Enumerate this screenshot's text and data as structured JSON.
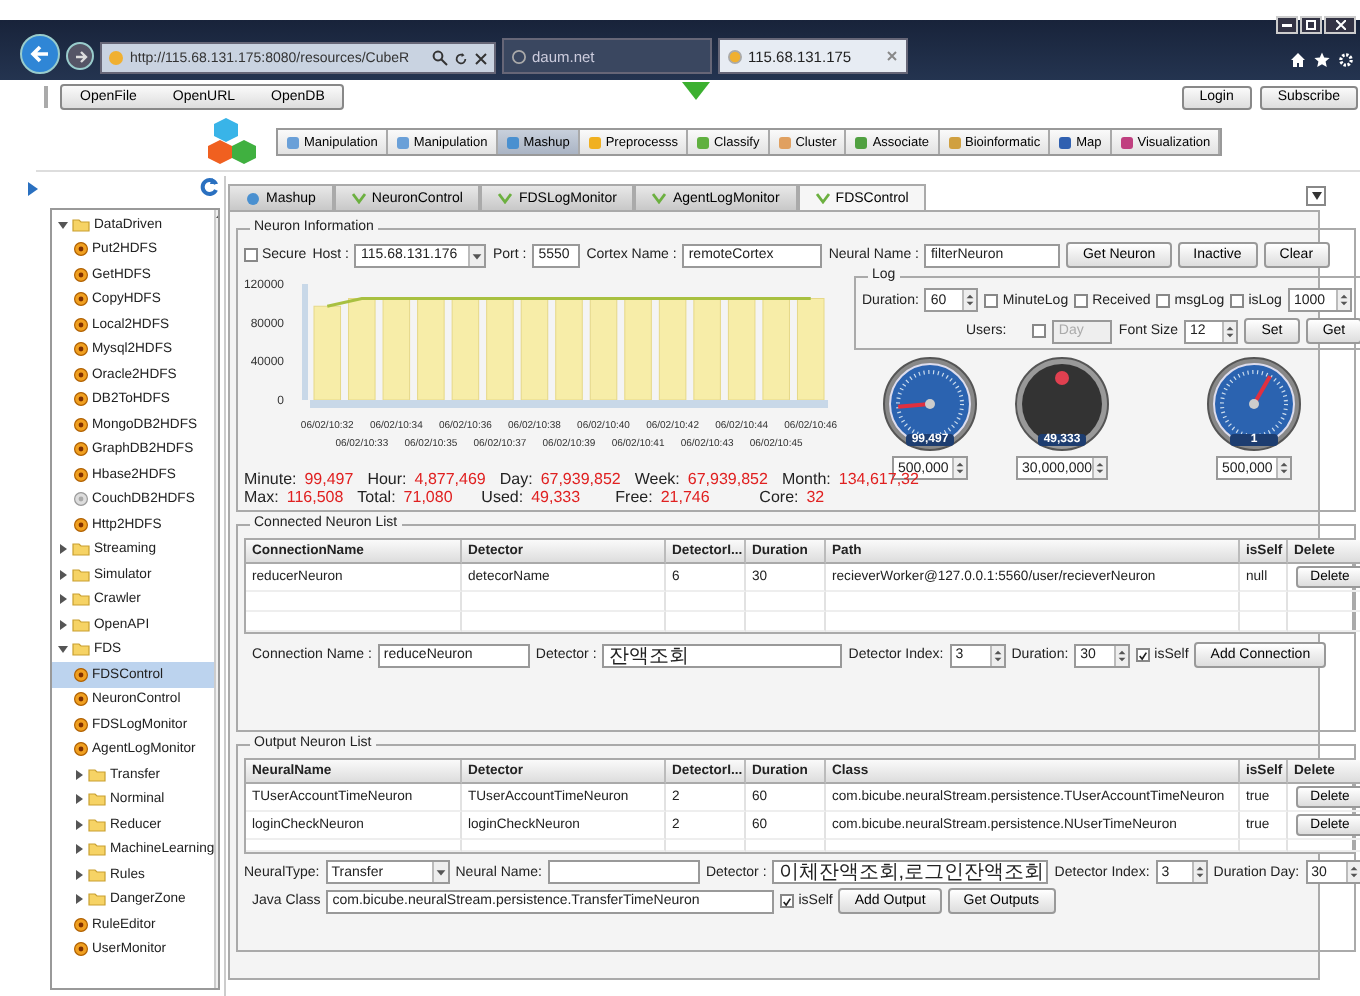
{
  "browser": {
    "address": "http://115.68.131.175:8080/resources/CubeR",
    "tabs": [
      {
        "label": "daum.net",
        "selected": false
      },
      {
        "label": "115.68.131.175",
        "selected": true
      }
    ]
  },
  "toolbar": {
    "file_buttons": [
      "OpenFile",
      "OpenURL",
      "OpenDB"
    ],
    "account_buttons": [
      "Login",
      "Subscribe"
    ]
  },
  "module_tabs": [
    {
      "label": "Manipulation",
      "selected": false
    },
    {
      "label": "Manipulation",
      "selected": false
    },
    {
      "label": "Mashup",
      "selected": true
    },
    {
      "label": "Preprocesss",
      "selected": false
    },
    {
      "label": "Classify",
      "selected": false
    },
    {
      "label": "Cluster",
      "selected": false
    },
    {
      "label": "Associate",
      "selected": false
    },
    {
      "label": "Bioinformatic",
      "selected": false
    },
    {
      "label": "Map",
      "selected": false
    },
    {
      "label": "Visualization",
      "selected": false
    }
  ],
  "sidebar": {
    "tree": [
      {
        "label": "DataDriven",
        "kind": "folder",
        "expanded": true,
        "selected": false,
        "children": [
          {
            "label": "Put2HDFS",
            "kind": "node",
            "disabled": false,
            "selected": false
          },
          {
            "label": "GetHDFS",
            "kind": "node",
            "disabled": false,
            "selected": false
          },
          {
            "label": "CopyHDFS",
            "kind": "node",
            "disabled": false,
            "selected": false
          },
          {
            "label": "Local2HDFS",
            "kind": "node",
            "disabled": false,
            "selected": false
          },
          {
            "label": "Mysql2HDFS",
            "kind": "node",
            "disabled": false,
            "selected": false
          },
          {
            "label": "Oracle2HDFS",
            "kind": "node",
            "disabled": false,
            "selected": false
          },
          {
            "label": "DB2ToHDFS",
            "kind": "node",
            "disabled": false,
            "selected": false
          },
          {
            "label": "MongoDB2HDFS",
            "kind": "node",
            "disabled": false,
            "selected": false
          },
          {
            "label": "GraphDB2HDFS",
            "kind": "node",
            "disabled": false,
            "selected": false
          },
          {
            "label": "Hbase2HDFS",
            "kind": "node",
            "disabled": false,
            "selected": false
          },
          {
            "label": "CouchDB2HDFS",
            "kind": "node",
            "disabled": true,
            "selected": false
          },
          {
            "label": "Http2HDFS",
            "kind": "node",
            "disabled": false,
            "selected": false
          }
        ]
      },
      {
        "label": "Streaming",
        "kind": "folder",
        "expanded": false,
        "selected": false
      },
      {
        "label": "Simulator",
        "kind": "folder",
        "expanded": false,
        "selected": false
      },
      {
        "label": "Crawler",
        "kind": "folder",
        "expanded": false,
        "selected": false
      },
      {
        "label": "OpenAPI",
        "kind": "folder",
        "expanded": false,
        "selected": false
      },
      {
        "label": "FDS",
        "kind": "folder",
        "expanded": true,
        "selected": false,
        "children": [
          {
            "label": "FDSControl",
            "kind": "node",
            "disabled": false,
            "selected": true
          },
          {
            "label": "NeuronControl",
            "kind": "node",
            "disabled": false,
            "selected": false
          },
          {
            "label": "FDSLogMonitor",
            "kind": "node",
            "disabled": false,
            "selected": false
          },
          {
            "label": "AgentLogMonitor",
            "kind": "node",
            "disabled": false,
            "selected": false
          },
          {
            "label": "Transfer",
            "kind": "folder",
            "expanded": false,
            "selected": false
          },
          {
            "label": "Norminal",
            "kind": "folder",
            "expanded": false,
            "selected": false
          },
          {
            "label": "Reducer",
            "kind": "folder",
            "expanded": false,
            "selected": false
          },
          {
            "label": "MachineLearning",
            "kind": "folder",
            "expanded": false,
            "selected": false
          },
          {
            "label": "Rules",
            "kind": "folder",
            "expanded": false,
            "selected": false
          },
          {
            "label": "DangerZone",
            "kind": "folder",
            "expanded": false,
            "selected": false
          },
          {
            "label": "RuleEditor",
            "kind": "node",
            "disabled": false,
            "selected": false
          },
          {
            "label": "UserMonitor",
            "kind": "node",
            "disabled": false,
            "selected": false
          }
        ]
      }
    ]
  },
  "panel_tabs": [
    {
      "label": "Mashup",
      "selected": false
    },
    {
      "label": "NeuronControl",
      "selected": false
    },
    {
      "label": "FDSLogMonitor",
      "selected": false
    },
    {
      "label": "AgentLogMonitor",
      "selected": false
    },
    {
      "label": "FDSControl",
      "selected": true
    }
  ],
  "neuron_info": {
    "title": "Neuron Information",
    "secure": {
      "label": "Secure",
      "checked": false
    },
    "host_label": "Host :",
    "host": "115.68.131.176",
    "port_label": "Port :",
    "port": "5550",
    "cortex_label": "Cortex Name :",
    "cortex": "remoteCortex",
    "neural_label": "Neural Name :",
    "neural": "filterNeuron",
    "buttons": [
      "Get Neuron",
      "Inactive",
      "Clear"
    ],
    "chart_data": {
      "type": "bar",
      "categories": [
        "06/02/10:32",
        "06/02/10:33",
        "06/02/10:34",
        "06/02/10:35",
        "06/02/10:36",
        "06/02/10:37",
        "06/02/10:38",
        "06/02/10:39",
        "06/02/10:40",
        "06/02/10:41",
        "06/02/10:42",
        "06/02/10:43",
        "06/02/10:44",
        "06/02/10:45",
        "06/02/10:46"
      ],
      "values": [
        97000,
        105000,
        105000,
        105000,
        105000,
        105000,
        105000,
        105000,
        105000,
        105000,
        105000,
        105000,
        105000,
        105000,
        105000
      ],
      "ylim": [
        0,
        120000
      ],
      "yticks": [
        0,
        40000,
        80000,
        120000
      ]
    },
    "log": {
      "title": "Log",
      "duration_label": "Duration:",
      "duration": "60",
      "checks": [
        {
          "label": "MinuteLog",
          "checked": false
        },
        {
          "label": "Received",
          "checked": false
        },
        {
          "label": "msgLog",
          "checked": false
        },
        {
          "label": "isLog",
          "checked": false
        }
      ],
      "count": "1000",
      "users_label": "Users:",
      "users_checked": false,
      "period": "Day",
      "period_disabled": true,
      "font_size_label": "Font Size",
      "font_size": "12",
      "buttons": [
        "Set",
        "Get"
      ]
    },
    "gauges": [
      {
        "kind": "dial",
        "reading": "99,497",
        "limit": "500,000"
      },
      {
        "kind": "lamp",
        "reading": "49,333",
        "limit": "30,000,000"
      },
      {
        "kind": "dial",
        "reading": "1",
        "limit": "500,000"
      }
    ],
    "stats": [
      [
        {
          "label": "Minute:",
          "value": "99,497"
        },
        {
          "label": "Hour:",
          "value": "4,877,469"
        },
        {
          "label": "Day:",
          "value": "67,939,852"
        },
        {
          "label": "Week:",
          "value": "67,939,852"
        },
        {
          "label": "Month:",
          "value": "134,617,32"
        }
      ],
      [
        {
          "label": "Max:",
          "value": "116,508"
        },
        {
          "label": "Total:",
          "value": "71,080"
        },
        {
          "label": "Used:",
          "value": "49,333"
        },
        {
          "label": "Free:",
          "value": "21,746"
        },
        {
          "label": "Core:",
          "value": "32"
        }
      ]
    ]
  },
  "connected": {
    "title": "Connected Neuron List",
    "columns": [
      "ConnectionName",
      "Detector",
      "DetectorI...",
      "Duration",
      "Path",
      "isSelf",
      "Delete"
    ],
    "rows": [
      {
        "cells": [
          "reducerNeuron",
          "detecorName",
          "6",
          "30",
          "recieverWorker@127.0.0.1:5560/user/recieverNeuron",
          "null"
        ],
        "action": "Delete"
      }
    ],
    "form": {
      "name_label": "Connection Name :",
      "name": "reduceNeuron",
      "detector_label": "Detector :",
      "detector": "잔액조회",
      "index_label": "Detector Index:",
      "index": "3",
      "duration_label": "Duration:",
      "duration": "30",
      "is_self": {
        "label": "isSelf",
        "checked": true
      },
      "button": "Add Connection"
    }
  },
  "output": {
    "title": "Output Neuron List",
    "columns": [
      "NeuralName",
      "Detector",
      "DetectorI...",
      "Duration",
      "Class",
      "isSelf",
      "Delete"
    ],
    "rows": [
      {
        "cells": [
          "TUserAccountTimeNeuron",
          "TUserAccountTimeNeuron",
          "2",
          "60",
          "com.bicube.neuralStream.persistence.TUserAccountTimeNeuron",
          "true"
        ],
        "action": "Delete"
      },
      {
        "cells": [
          "loginCheckNeuron",
          "loginCheckNeuron",
          "2",
          "60",
          "com.bicube.neuralStream.persistence.NUserTimeNeuron",
          "true"
        ],
        "action": "Delete"
      }
    ],
    "form": {
      "type_label": "NeuralType:",
      "type": "Transfer",
      "name_label": "Neural Name:",
      "detector_label": "Detector :",
      "detector": "이체잔액조회,로그인잔액조회",
      "index_label": "Detector Index:",
      "index": "3",
      "duration_label": "Duration Day:",
      "duration": "30",
      "class_label": "Java Class",
      "class": "com.bicube.neuralStream.persistence.TransferTimeNeuron",
      "is_self": {
        "label": "isSelf",
        "checked": true
      },
      "buttons": [
        "Add Output",
        "Get Outputs"
      ]
    }
  }
}
